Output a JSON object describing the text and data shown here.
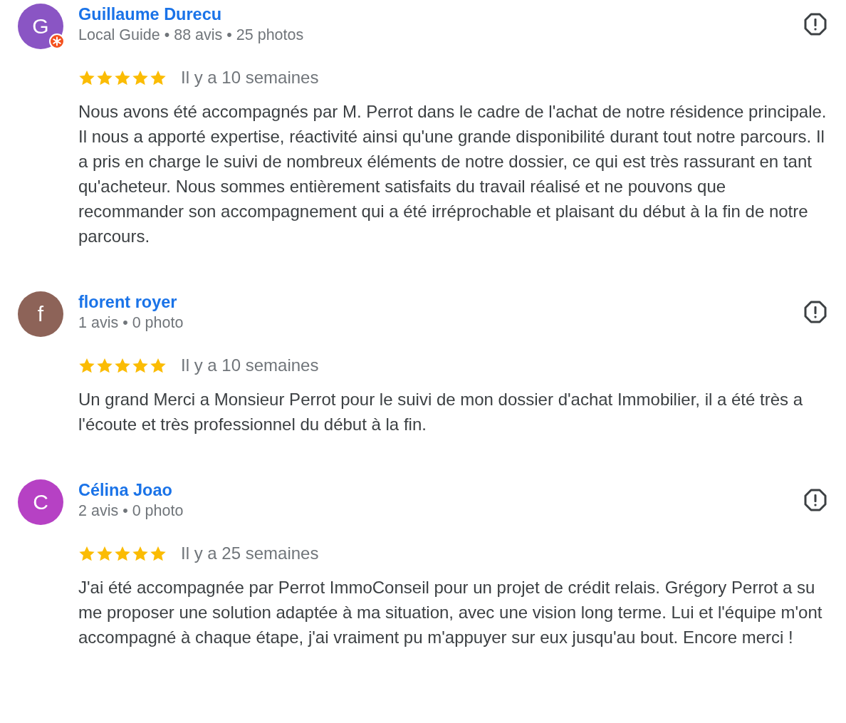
{
  "reviews": [
    {
      "initial": "G",
      "color": "#8a55c4",
      "local_guide": true,
      "name": "Guillaume Durecu",
      "meta": "Local Guide • 88 avis • 25 photos",
      "stars": 5,
      "time": "Il y a 10 semaines",
      "text": "Nous avons été accompagnés par M. Perrot dans le cadre de l'achat de notre résidence principale. Il nous a apporté expertise, réactivité ainsi qu'une grande disponibilité durant tout notre parcours. Il a pris en charge le suivi de nombreux éléments de notre dossier, ce qui est très rassurant en tant qu'acheteur. Nous sommes entièrement satisfaits du travail réalisé et ne pouvons que recommander son accompagnement qui a été irréprochable et plaisant du début à la fin de notre parcours."
    },
    {
      "initial": "f",
      "color": "#8d6358",
      "local_guide": false,
      "name": "florent royer",
      "meta": "1 avis • 0 photo",
      "stars": 5,
      "time": "Il y a 10 semaines",
      "text": "Un grand Merci a Monsieur Perrot pour le suivi de mon dossier d'achat Immobilier, il a été très a l'écoute et très professionnel du début à la fin."
    },
    {
      "initial": "C",
      "color": "#b641c4",
      "local_guide": false,
      "name": "Célina Joao",
      "meta": "2 avis • 0 photo",
      "stars": 5,
      "time": "Il y a 25 semaines",
      "text": "J'ai été accompagnée par Perrot ImmoConseil pour un projet de crédit relais. Grégory Perrot a su me proposer une solution adaptée à ma situation, avec une vision long terme. Lui et l'équipe m'ont accompagné à chaque étape, j'ai vraiment pu m'appuyer sur eux jusqu'au bout. Encore merci !"
    }
  ]
}
